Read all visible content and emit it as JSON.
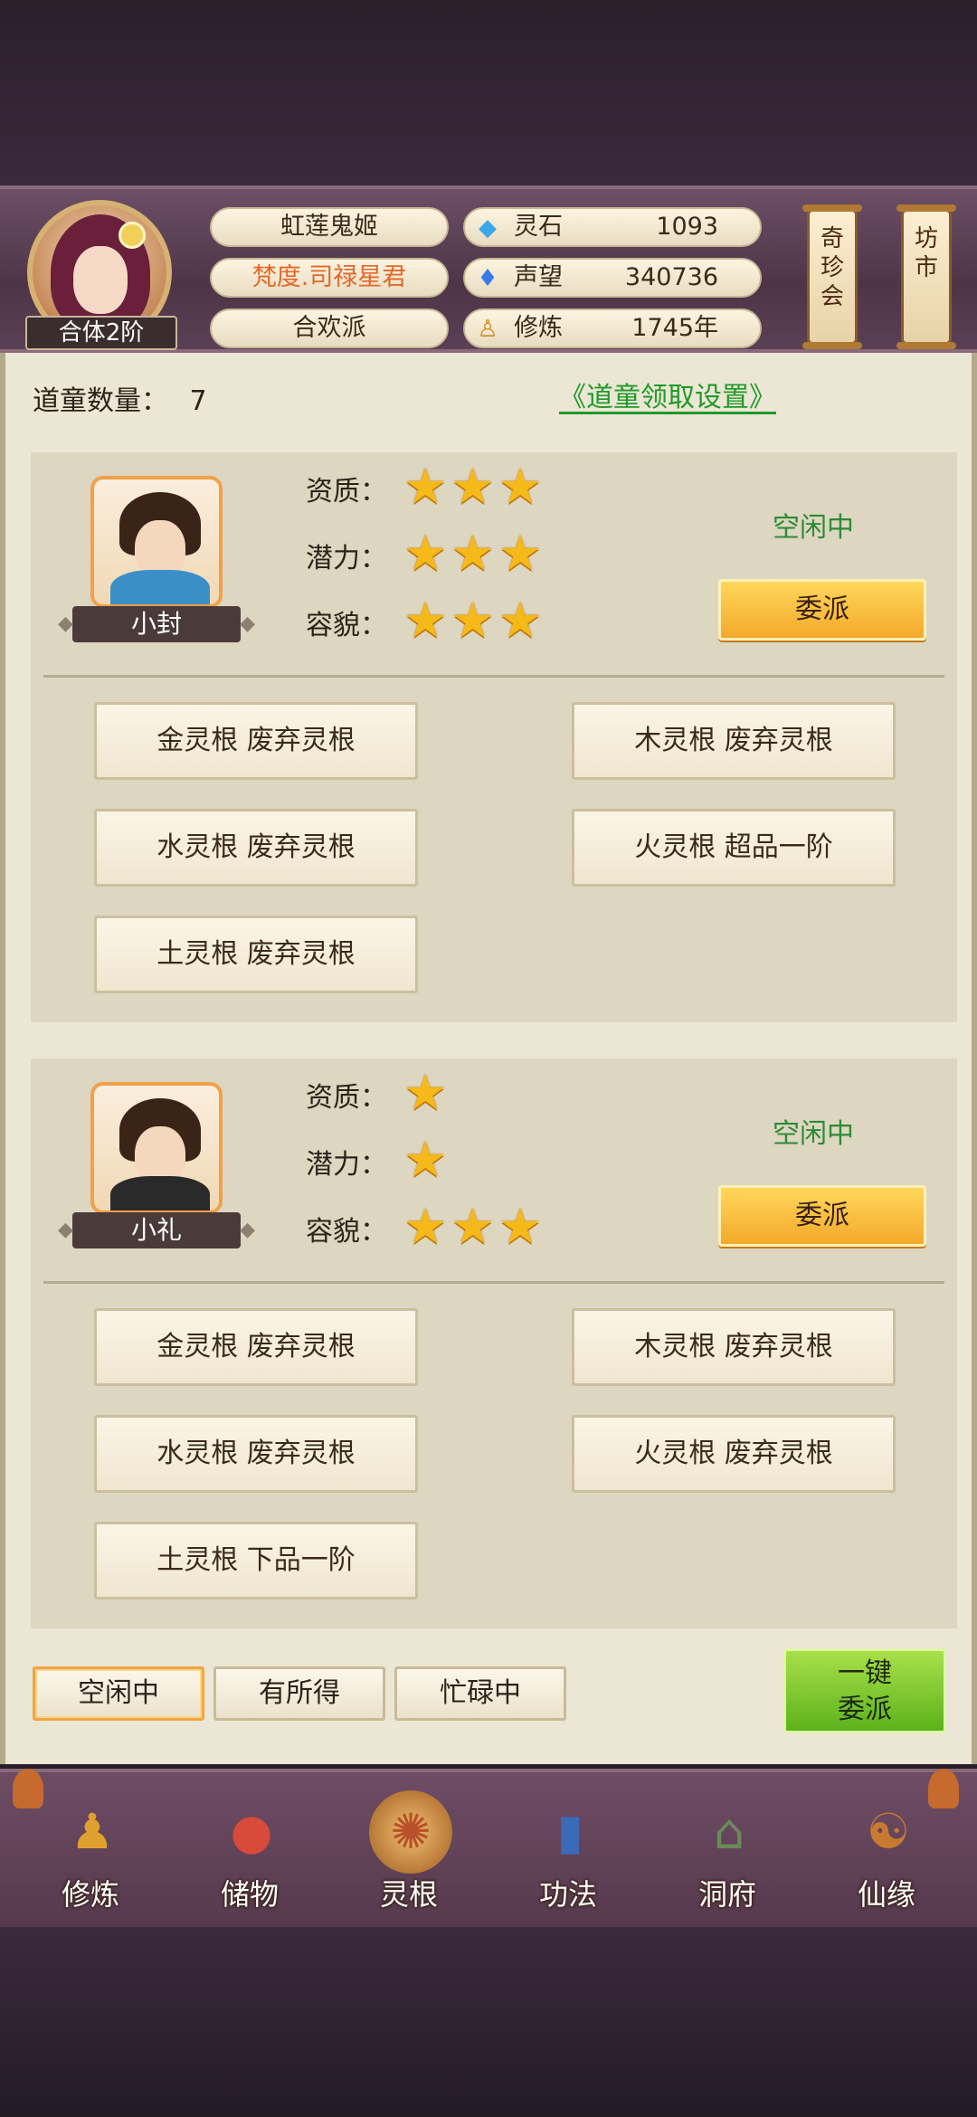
{
  "player": {
    "name": "虹莲鬼姬",
    "title": "梵度.司禄星君",
    "sect": "合欢派",
    "rank": "合体2阶"
  },
  "resources": [
    {
      "icon": "spirit-stone-icon",
      "glyph": "◆",
      "color": "#3aa8e8",
      "label": "灵石",
      "value": "1093"
    },
    {
      "icon": "reputation-flame-icon",
      "glyph": "♦",
      "color": "#3a7ae8",
      "label": "声望",
      "value": "340736"
    },
    {
      "icon": "meditation-icon",
      "glyph": "♙",
      "color": "#d08a20",
      "label": "修炼",
      "value": "1745年"
    }
  ],
  "side_buttons": {
    "treasure": "奇珍会",
    "market": "坊市"
  },
  "panel": {
    "count_label": "道童数量：",
    "count_value": "7",
    "settings_link": "《道童领取设置》"
  },
  "disciples": [
    {
      "name": "小封",
      "stats": [
        {
          "label": "资质：",
          "stars": 3
        },
        {
          "label": "潜力：",
          "stars": 3
        },
        {
          "label": "容貌：",
          "stars": 3
        }
      ],
      "status": "空闲中",
      "assign_label": "委派",
      "roots": [
        "金灵根 废弃灵根",
        "木灵根 废弃灵根",
        "水灵根 废弃灵根",
        "火灵根 超品一阶",
        "土灵根 废弃灵根"
      ]
    },
    {
      "name": "小礼",
      "stats": [
        {
          "label": "资质：",
          "stars": 1
        },
        {
          "label": "潜力：",
          "stars": 1
        },
        {
          "label": "容貌：",
          "stars": 3
        }
      ],
      "status": "空闲中",
      "assign_label": "委派",
      "roots": [
        "金灵根 废弃灵根",
        "木灵根 废弃灵根",
        "水灵根 废弃灵根",
        "火灵根 废弃灵根",
        "土灵根 下品一阶"
      ]
    }
  ],
  "filters": [
    "空闲中",
    "有所得",
    "忙碌中"
  ],
  "active_filter": "空闲中",
  "onekey": {
    "line1": "一键",
    "line2": "委派"
  },
  "nav": [
    {
      "label": "修炼",
      "icon": "cultivate-icon",
      "glyph": "♟",
      "color": "#e0a030"
    },
    {
      "label": "储物",
      "icon": "storage-bag-icon",
      "glyph": "●",
      "color": "#d84a3a"
    },
    {
      "label": "灵根",
      "icon": "spirit-root-icon",
      "glyph": "✺",
      "color": "#b8502a"
    },
    {
      "label": "功法",
      "icon": "technique-book-icon",
      "glyph": "▮",
      "color": "#3a6ab8"
    },
    {
      "label": "洞府",
      "icon": "cave-residence-icon",
      "glyph": "⌂",
      "color": "#6a8a5a"
    },
    {
      "label": "仙缘",
      "icon": "immortal-fate-icon",
      "glyph": "☯",
      "color": "#c87a30"
    }
  ],
  "colors": {
    "accent_gold": "#f3a92a",
    "status_green": "#2e8a36",
    "link_green": "#1f9a2a",
    "star": "#f5b91a"
  }
}
